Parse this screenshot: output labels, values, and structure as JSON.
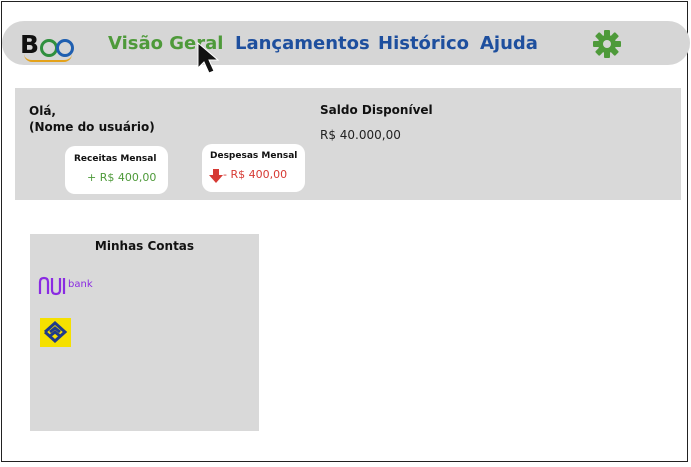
{
  "nav": {
    "logo_text": "Boo",
    "items": [
      {
        "label": "Visão Geral"
      },
      {
        "label": "Lançamentos"
      },
      {
        "label": "Histórico"
      },
      {
        "label": "Ajuda"
      }
    ],
    "active_color": "#4e9a3a",
    "link_color": "#1e4f9e"
  },
  "summary": {
    "greeting_line1": "Olá,",
    "greeting_line2": "(Nome do usuário)",
    "balance_label": "Saldo Disponível",
    "balance_value": "R$ 40.000,00",
    "income": {
      "title": "Receitas Mensal",
      "value": "+ R$ 400,00"
    },
    "expense": {
      "title": "Despesas Mensal",
      "value": "- R$ 400,00"
    }
  },
  "accounts": {
    "title": "Minhas Contas",
    "items": [
      {
        "name": "nubank",
        "label": "bank",
        "icon": "nubank-logo"
      },
      {
        "name": "banco-do-brasil",
        "icon": "banco-do-brasil-logo"
      }
    ]
  }
}
